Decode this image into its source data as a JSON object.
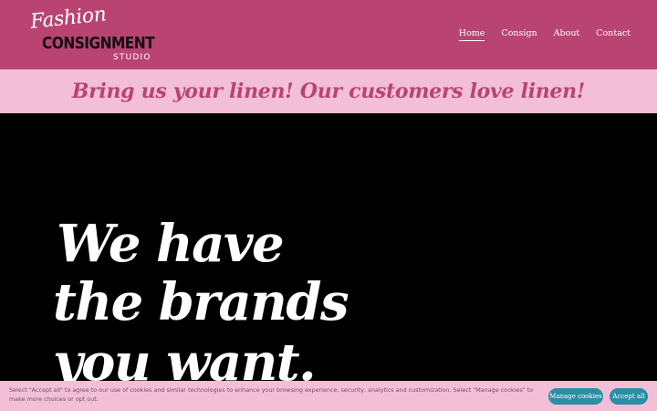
{
  "header": {
    "logo": {
      "script": "Fashion",
      "main": "CONSIGNMENT",
      "sub": "STUDIO"
    },
    "nav": [
      {
        "label": "Home",
        "active": true
      },
      {
        "label": "Consign",
        "active": false
      },
      {
        "label": "About",
        "active": false
      },
      {
        "label": "Contact",
        "active": false
      }
    ]
  },
  "banner": {
    "text": "Bring us your linen! Our customers love linen!"
  },
  "hero": {
    "lines": [
      "We have",
      "the brands",
      "you want."
    ]
  },
  "cookie": {
    "text": "Select \"Accept all\" to agree to our use of cookies and similar technologies to enhance your browsing experience, security, analytics and customization. Select \"Manage cookies\" to make more choices or opt out.",
    "manage_label": "Manage cookies",
    "accept_label": "Accept all"
  },
  "colors": {
    "header_bg": "#b94471",
    "banner_bg": "#f2bfd6",
    "hero_bg": "#000000",
    "button_bg": "#2a8fa5"
  }
}
